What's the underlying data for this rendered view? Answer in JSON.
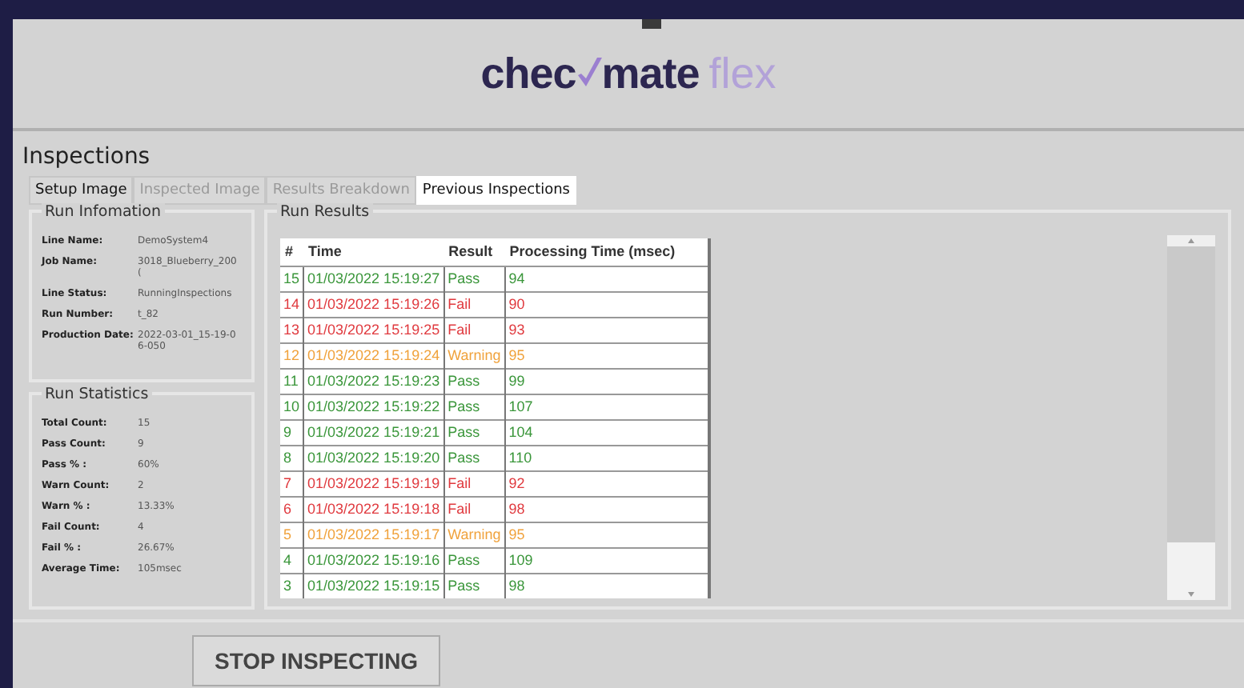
{
  "logo": {
    "brand_start": "chec",
    "brand_end": "mate",
    "suffix": "flex"
  },
  "section_title": "Inspections",
  "tabs": [
    {
      "label": "Setup Image",
      "selected": false,
      "disabled": false
    },
    {
      "label": "Inspected Image",
      "selected": false,
      "disabled": true
    },
    {
      "label": "Results Breakdown",
      "selected": false,
      "disabled": true
    },
    {
      "label": "Previous Inspections",
      "selected": true,
      "disabled": false
    }
  ],
  "run_information": {
    "title": "Run Infomation",
    "fields": [
      {
        "label": "Line Name:",
        "value": "DemoSystem4"
      },
      {
        "label": "Job Name:",
        "value": "3018_Blueberry_200("
      },
      {
        "label": "Line Status:",
        "value": "RunningInspections"
      },
      {
        "label": "Run Number:",
        "value": "t_82"
      },
      {
        "label": "Production Date:",
        "value": "2022-03-01_15-19-06-050"
      }
    ]
  },
  "run_statistics": {
    "title": "Run Statistics",
    "fields": [
      {
        "label": "Total Count:",
        "value": "15"
      },
      {
        "label": "Pass Count:",
        "value": "9"
      },
      {
        "label": "Pass % :",
        "value": "60%"
      },
      {
        "label": "Warn Count:",
        "value": "2"
      },
      {
        "label": "Warn % :",
        "value": "13.33%"
      },
      {
        "label": "Fail Count:",
        "value": "4"
      },
      {
        "label": "Fail % :",
        "value": "26.67%"
      },
      {
        "label": "Average Time:",
        "value": "105msec"
      }
    ]
  },
  "run_results": {
    "title": "Run Results",
    "columns": [
      "#",
      "Time",
      "Result",
      "Processing Time (msec)"
    ],
    "rows": [
      {
        "cells": [
          "15",
          "01/03/2022 15:19:27",
          "Pass",
          "94"
        ],
        "color": "#3a963a"
      },
      {
        "cells": [
          "14",
          "01/03/2022 15:19:26",
          "Fail",
          "90"
        ],
        "color": "#e0393e"
      },
      {
        "cells": [
          "13",
          "01/03/2022 15:19:25",
          "Fail",
          "93"
        ],
        "color": "#e0393e"
      },
      {
        "cells": [
          "12",
          "01/03/2022 15:19:24",
          "Warning",
          "95"
        ],
        "color": "#f0a23c"
      },
      {
        "cells": [
          "11",
          "01/03/2022 15:19:23",
          "Pass",
          "99"
        ],
        "color": "#3a963a"
      },
      {
        "cells": [
          "10",
          "01/03/2022 15:19:22",
          "Pass",
          "107"
        ],
        "color": "#3a963a"
      },
      {
        "cells": [
          "9",
          "01/03/2022 15:19:21",
          "Pass",
          "104"
        ],
        "color": "#3a963a"
      },
      {
        "cells": [
          "8",
          "01/03/2022 15:19:20",
          "Pass",
          "110"
        ],
        "color": "#3a963a"
      },
      {
        "cells": [
          "7",
          "01/03/2022 15:19:19",
          "Fail",
          "92"
        ],
        "color": "#e0393e"
      },
      {
        "cells": [
          "6",
          "01/03/2022 15:19:18",
          "Fail",
          "98"
        ],
        "color": "#e0393e"
      },
      {
        "cells": [
          "5",
          "01/03/2022 15:19:17",
          "Warning",
          "95"
        ],
        "color": "#f0a23c"
      },
      {
        "cells": [
          "4",
          "01/03/2022 15:19:16",
          "Pass",
          "109"
        ],
        "color": "#3a963a"
      },
      {
        "cells": [
          "3",
          "01/03/2022 15:19:15",
          "Pass",
          "98"
        ],
        "color": "#3a963a"
      }
    ]
  },
  "action_button": "STOP INSPECTING"
}
